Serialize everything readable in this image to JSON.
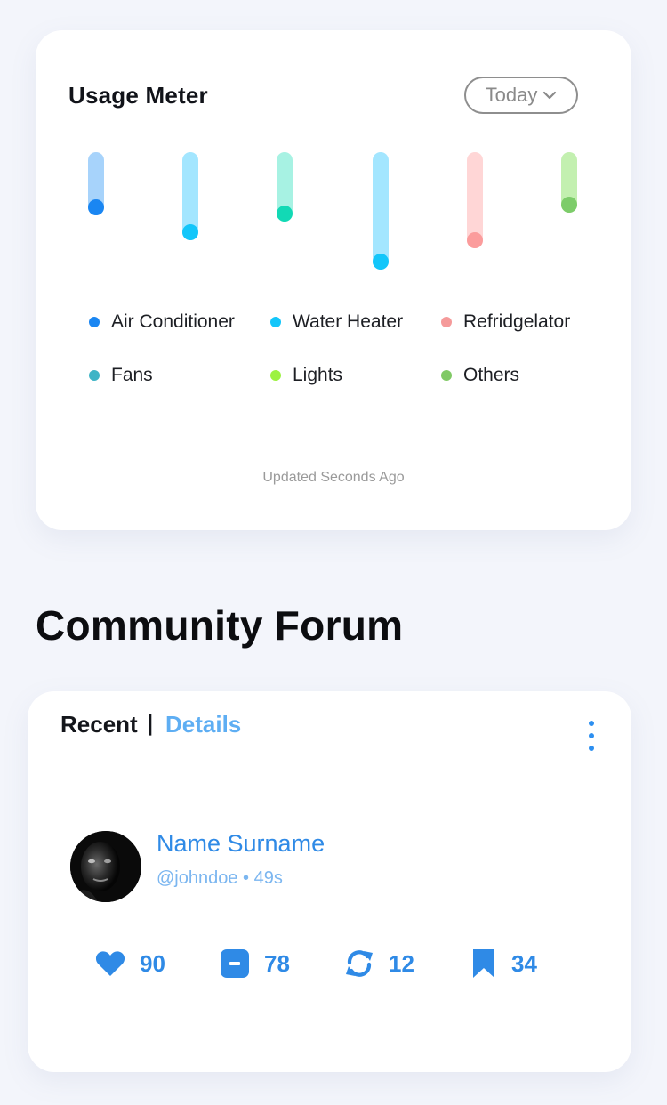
{
  "colors": {
    "background": "#f3f5fb",
    "card": "#ffffff",
    "accent_blue": "#2f8ae6",
    "link_blue": "#5eaef3",
    "muted_text": "#9a9a9a"
  },
  "usage_meter": {
    "title": "Usage Meter",
    "period_select": {
      "selected": "Today",
      "icon": "chevron-down-icon"
    },
    "meters": [
      {
        "level": 0.47,
        "track_color": "#a7d3fb",
        "dot_color": "#1a86f2"
      },
      {
        "level": 0.66,
        "track_color": "#a3e6ff",
        "dot_color": "#13c6fa"
      },
      {
        "level": 0.52,
        "track_color": "#a7f2e3",
        "dot_color": "#12d9b5"
      },
      {
        "level": 0.88,
        "track_color": "#a3e6ff",
        "dot_color": "#13c6fa"
      },
      {
        "level": 0.72,
        "track_color": "#ffd6d6",
        "dot_color": "#fb9c9c"
      },
      {
        "level": 0.45,
        "track_color": "#c3f0b0",
        "dot_color": "#7dcc6a"
      }
    ],
    "legend": [
      {
        "label": "Air Conditioner",
        "color": "#1a86f2"
      },
      {
        "label": "Water Heater",
        "color": "#13c6fa"
      },
      {
        "label": "Refridgelator",
        "color": "#f59a9a"
      },
      {
        "label": "Fans",
        "color": "#3fb4c6"
      },
      {
        "label": "Lights",
        "color": "#9cf241"
      },
      {
        "label": "Others",
        "color": "#80c965"
      }
    ],
    "updated_text": "Updated Seconds Ago"
  },
  "forum": {
    "heading": "Community Forum",
    "tabs": {
      "recent": "Recent",
      "separator": "|",
      "details": "Details"
    },
    "more_icon": "vertical-ellipsis-icon",
    "post": {
      "avatar": "avatar-photo",
      "name": "Name Surname",
      "meta": "@johndoe • 49s",
      "stats": [
        {
          "icon": "heart-icon",
          "count": "90"
        },
        {
          "icon": "comment-icon",
          "count": "78"
        },
        {
          "icon": "repost-icon",
          "count": "12"
        },
        {
          "icon": "bookmark-icon",
          "count": "34"
        }
      ]
    }
  }
}
